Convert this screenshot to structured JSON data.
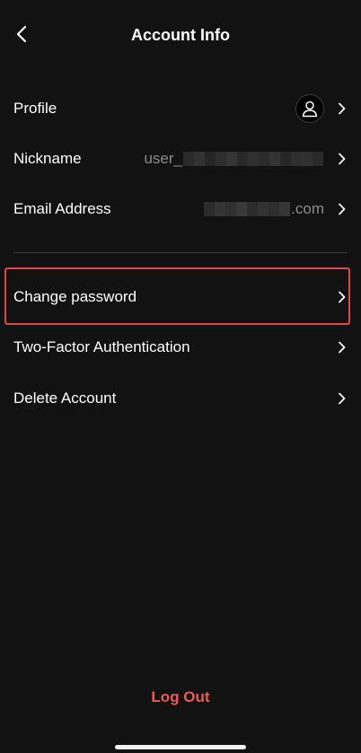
{
  "header": {
    "title": "Account Info",
    "back_icon": "chevron-left-icon"
  },
  "account": {
    "profile_label": "Profile",
    "nickname_label": "Nickname",
    "nickname_value_prefix": "user_",
    "email_label": "Email Address",
    "email_value_suffix": ".com"
  },
  "security": {
    "change_password_label": "Change password",
    "two_factor_label": "Two-Factor Authentication",
    "delete_account_label": "Delete Account"
  },
  "footer": {
    "logout_label": "Log Out"
  },
  "colors": {
    "background": "#121212",
    "text": "#ffffff",
    "secondary_text": "#8c8c8c",
    "accent_red": "#ef5a55",
    "highlight_border": "#e0484a",
    "divider": "#3a3a3a"
  }
}
